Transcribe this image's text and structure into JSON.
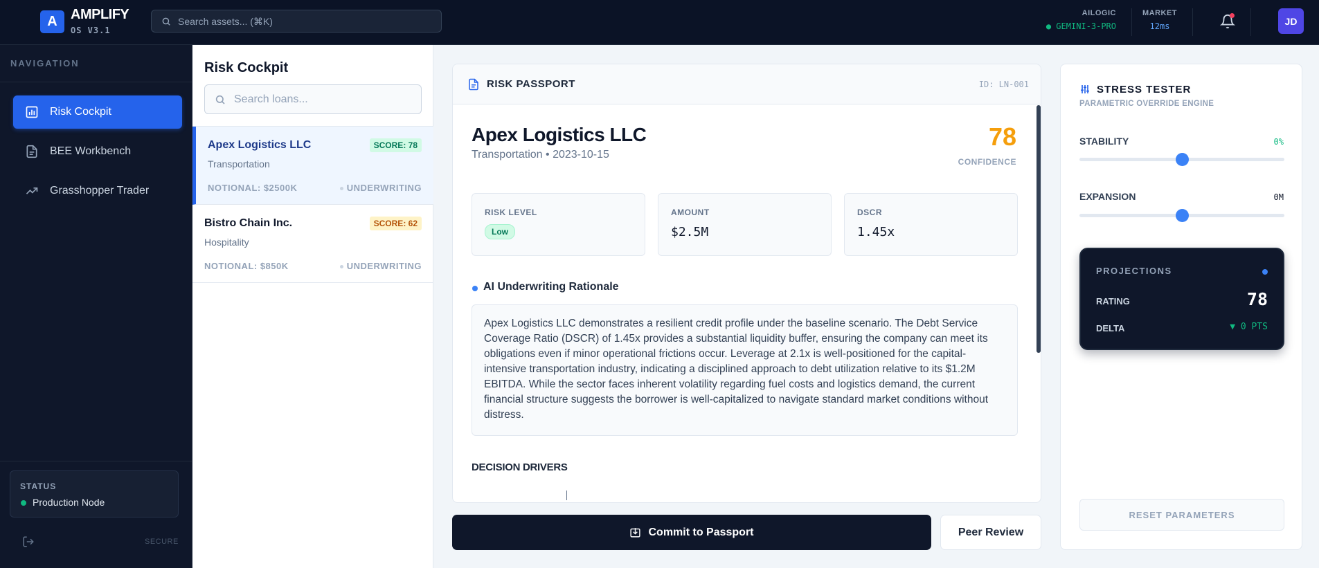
{
  "app": {
    "logo_letter": "A",
    "name": "AMPLIFY",
    "version": "OS V3.1"
  },
  "topbar": {
    "search_placeholder": "Search assets... (⌘K)",
    "ailogic_label": "AILOGIC",
    "ailogic_value": "● GEMINI-3-PRO",
    "market_label": "MARKET",
    "market_value": "12ms",
    "user_initials": "JD",
    "notification_icon": "bell-icon"
  },
  "sidebar": {
    "title": "NAVIGATION",
    "items": [
      {
        "label": "Risk Cockpit",
        "icon": "bar-chart-icon",
        "active": true
      },
      {
        "label": "BEE Workbench",
        "icon": "document-icon",
        "active": false
      },
      {
        "label": "Grasshopper Trader",
        "icon": "trend-up-icon",
        "active": false
      }
    ],
    "status_label": "STATUS",
    "status_value": "Production Node",
    "secure_label": "SECURE"
  },
  "loan_list": {
    "title": "Risk Cockpit",
    "search_placeholder": "Search loans...",
    "loans": [
      {
        "name": "Apex Logistics LLC",
        "category": "Transportation",
        "score": "SCORE: 78",
        "notional": "NOTIONAL: $2500K",
        "stage": "UNDERWRITING",
        "active": true
      },
      {
        "name": "Bistro Chain Inc.",
        "category": "Hospitality",
        "score": "SCORE: 62",
        "notional": "NOTIONAL: $850K",
        "stage": "UNDERWRITING",
        "active": false
      }
    ]
  },
  "passport": {
    "header_title": "RISK PASSPORT",
    "id": "ID: LN-001",
    "company": "Apex Logistics LLC",
    "subtitle": "Transportation • 2023-10-15",
    "score": "78",
    "score_label": "CONFIDENCE",
    "metrics": [
      {
        "label": "RISK LEVEL",
        "value": "Low"
      },
      {
        "label": "AMOUNT",
        "value": "$2.5M"
      },
      {
        "label": "DSCR",
        "value": "1.45x"
      }
    ],
    "rationale_title": "AI Underwriting Rationale",
    "rationale_text": "Apex Logistics LLC demonstrates a resilient credit profile under the baseline scenario. The Debt Service Coverage Ratio (DSCR) of 1.45x provides a substantial liquidity buffer, ensuring the company can meet its obligations even if minor operational frictions occur. Leverage at 2.1x is well-positioned for the capital-intensive transportation industry, indicating a disciplined approach to debt utilization relative to its $1.2M EBITDA. While the sector faces inherent volatility regarding fuel costs and logistics demand, the current financial structure suggests the borrower is well-capitalized to navigate standard market conditions without distress.",
    "drivers_title": "DECISION DRIVERS"
  },
  "actions": {
    "commit_label": "Commit to Passport",
    "peer_label": "Peer Review"
  },
  "stress_tester": {
    "title": "STRESS TESTER",
    "subtitle": "PARAMETRIC OVERRIDE ENGINE",
    "sliders": [
      {
        "label": "STABILITY",
        "value": "0%",
        "position": 0.5
      },
      {
        "label": "EXPANSION",
        "value": "0M",
        "position": 0.5
      }
    ],
    "projections": {
      "title": "PROJECTIONS",
      "rating_label": "RATING",
      "rating_value": "78",
      "delta_label": "DELTA",
      "delta_value": "▼ 0 PTS"
    },
    "reset_label": "RESET PARAMETERS"
  },
  "colors": {
    "accent": "#2563eb",
    "sidebar_bg": "#0f172a",
    "score_amber": "#f59e0b",
    "success": "#10b981"
  }
}
